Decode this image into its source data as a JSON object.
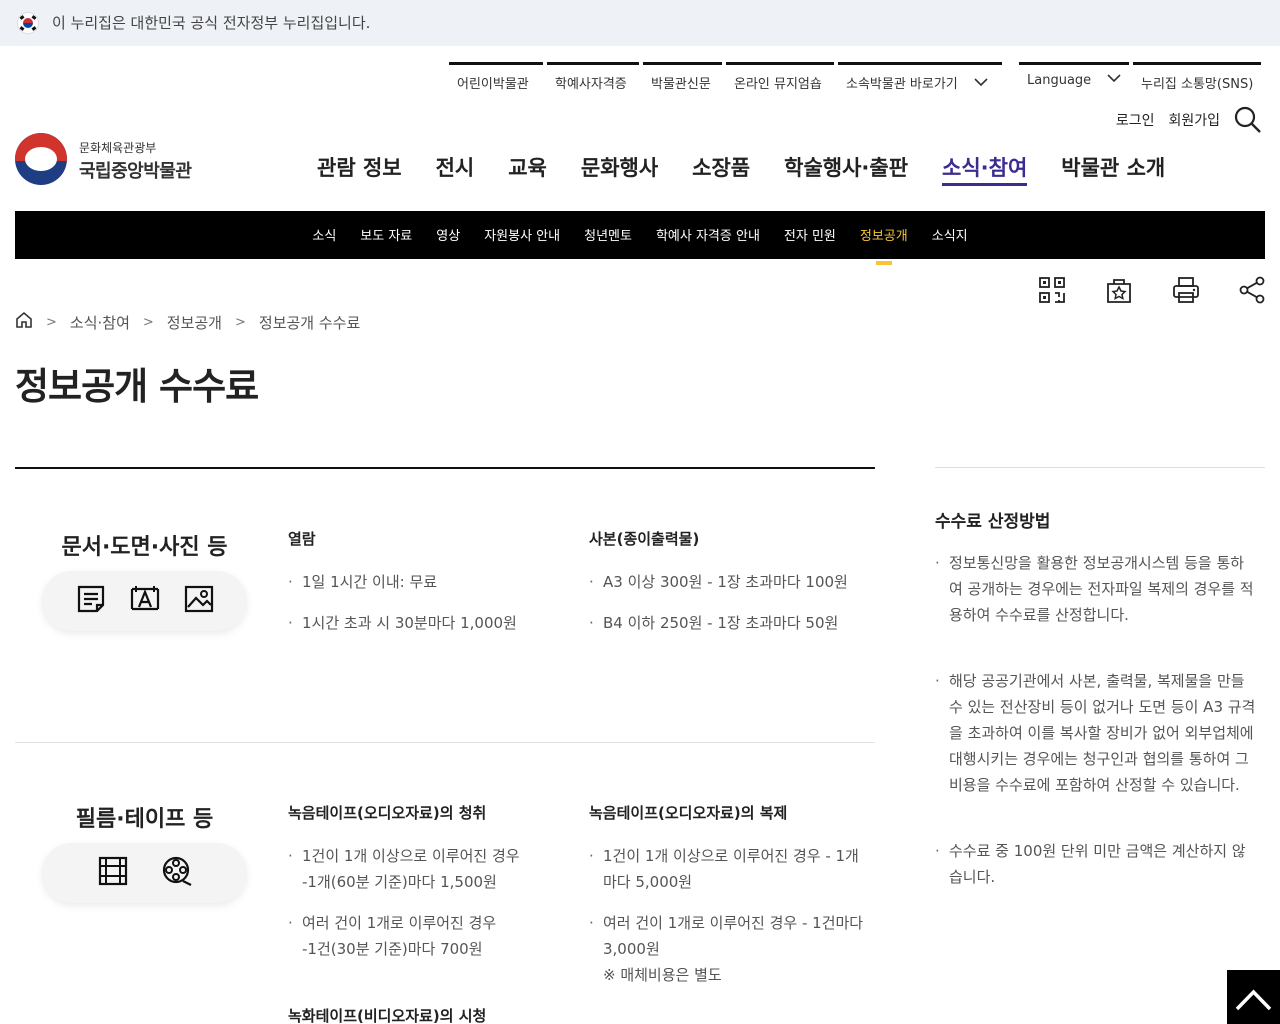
{
  "gov_banner": {
    "text": "이 누리집은 대한민국 공식 전자정부 누리집입니다."
  },
  "util_nav": {
    "links": [
      "어린이박물관",
      "학예사자격증",
      "박물관신문",
      "온라인 뮤지엄숍",
      "소속박물관 바로가기"
    ],
    "language": "Language",
    "sns": "누리집 소통망(SNS)"
  },
  "member": {
    "login": "로그인",
    "join": "회원가입"
  },
  "logo": {
    "ministry": "문화체육관광부",
    "name": "국립중앙박물관"
  },
  "gnb": [
    "관람 정보",
    "전시",
    "교육",
    "문화행사",
    "소장품",
    "학술행사·출판",
    "소식·참여",
    "박물관 소개"
  ],
  "lnb": [
    "소식",
    "보도 자료",
    "영상",
    "자원봉사 안내",
    "청년멘토",
    "학예사 자격증 안내",
    "전자 민원",
    "정보공개",
    "소식지"
  ],
  "breadcrumb": [
    "소식·참여",
    "정보공개",
    "정보공개 수수료"
  ],
  "page_title": "정보공개 수수료",
  "sections": {
    "docs": {
      "title": "문서·도면·사진 등",
      "icons": [
        "document-icon",
        "drawing-icon",
        "photo-icon"
      ],
      "col1": {
        "heading": "열람",
        "items": [
          "1일 1시간 이내: 무료",
          "1시간 초과 시 30분마다 1,000원"
        ]
      },
      "col2": {
        "heading": "사본(종이출력물)",
        "items": [
          "A3 이상 300원 - 1장 초과마다 100원",
          "B4 이하 250원 - 1장 초과마다 50원"
        ]
      }
    },
    "film": {
      "title": "필름·테이프 등",
      "icons": [
        "film-icon",
        "reel-icon"
      ],
      "col1": {
        "heading": "녹음테이프(오디오자료)의 청취",
        "items": [
          [
            "1건이 1개 이상으로 이루어진 경우",
            "-1개(60분 기준)마다 1,500원"
          ],
          [
            "여러 건이 1개로 이루어진 경우",
            "-1건(30분 기준)마다 700원"
          ]
        ],
        "heading2": "녹화테이프(비디오자료)의 시청"
      },
      "col2": {
        "heading": "녹음테이프(오디오자료)의 복제",
        "items": [
          [
            "1건이 1개 이상으로 이루어진 경우 - 1개",
            "마다 5,000원"
          ],
          [
            "여러 건이 1개로 이루어진 경우 - 1건마다",
            "3,000원"
          ]
        ],
        "note": "※ 매체비용은 별도"
      }
    }
  },
  "side": {
    "title": "수수료 산정방법",
    "paragraphs": [
      [
        "정보통신망을 활용한 정보공개시스템 등을 통하",
        "여 공개하는 경우에는 전자파일 복제의 경우를 적",
        "용하여 수수료를 산정합니다."
      ],
      [
        "해당 공공기관에서 사본, 출력물, 복제물을 만들",
        "수 있는 전산장비 등이 없거나 도면 등이 A3 규격",
        "을 초과하여 이를 복사할 장비가 없어 외부업체에",
        "대행시키는 경우에는 청구인과 협의를 통하여 그",
        "비용을 수수료에 포함하여 산정할 수 있습니다."
      ],
      [
        "수수료 중 100원 단위 미만 금액은 계산하지 않",
        "습니다."
      ]
    ]
  },
  "colors": {
    "active_menu": "#3b2c8f",
    "lnb_active": "#f7c533",
    "lnb_bg": "#000000"
  }
}
